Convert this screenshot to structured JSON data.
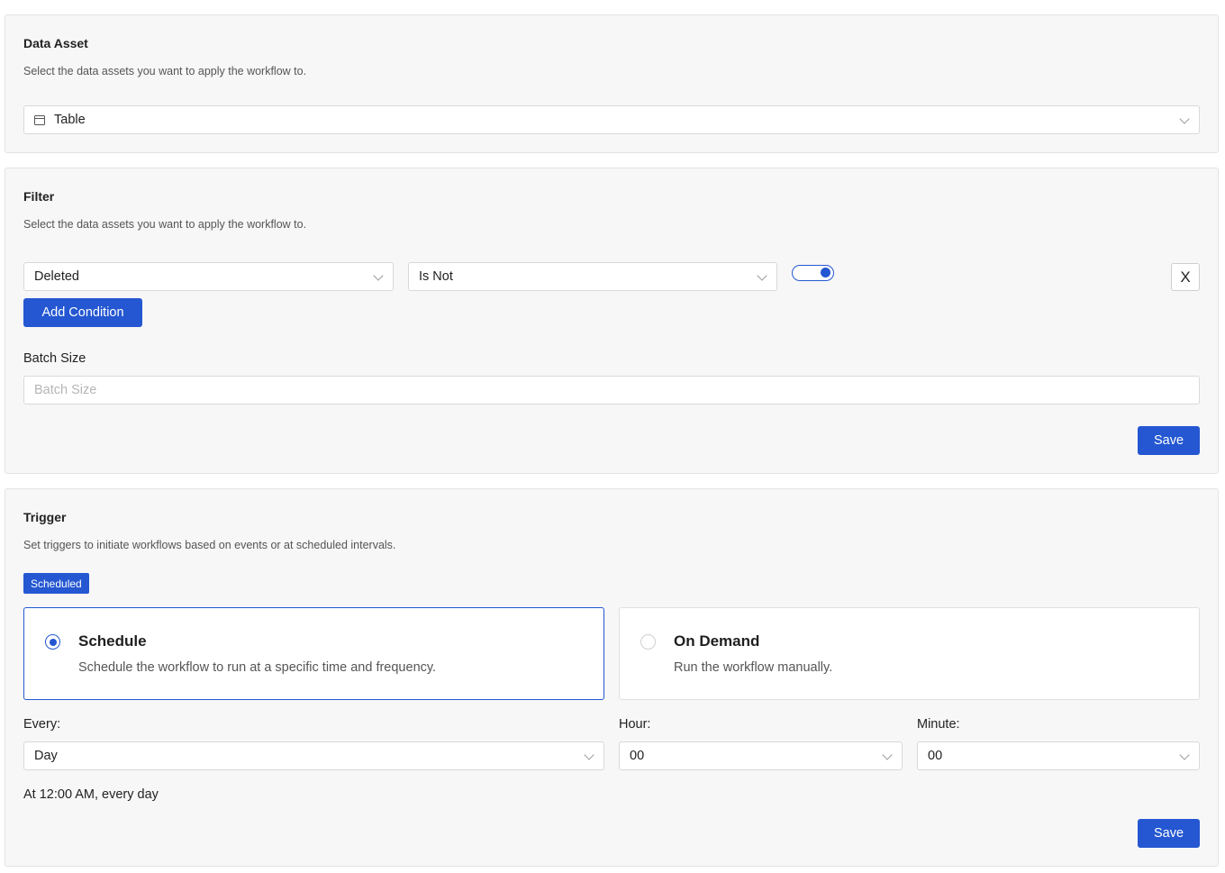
{
  "data_asset": {
    "title": "Data Asset",
    "description": "Select the data assets you want to apply the workflow to.",
    "selected": "Table",
    "icon": "table-icon"
  },
  "filter": {
    "title": "Filter",
    "description": "Select the data assets you want to apply the workflow to.",
    "field": "Deleted",
    "operator": "Is Not",
    "toggle_on": true,
    "remove_label": "X",
    "add_condition_label": "Add Condition",
    "batch_size_label": "Batch Size",
    "batch_size_placeholder": "Batch Size",
    "save_label": "Save"
  },
  "trigger": {
    "title": "Trigger",
    "description": "Set triggers to initiate workflows based on events or at scheduled intervals.",
    "badge": "Scheduled",
    "options": [
      {
        "title": "Schedule",
        "description": "Schedule the workflow to run at a specific time and frequency.",
        "selected": true
      },
      {
        "title": "On Demand",
        "description": "Run the workflow manually.",
        "selected": false
      }
    ],
    "every_label": "Every:",
    "every_value": "Day",
    "hour_label": "Hour:",
    "hour_value": "00",
    "minute_label": "Minute:",
    "minute_value": "00",
    "summary": "At 12:00 AM, every day",
    "save_label": "Save"
  },
  "colors": {
    "accent": "#2457d1",
    "card_bg": "#f7f7f7",
    "border": "#e3e3e3"
  }
}
